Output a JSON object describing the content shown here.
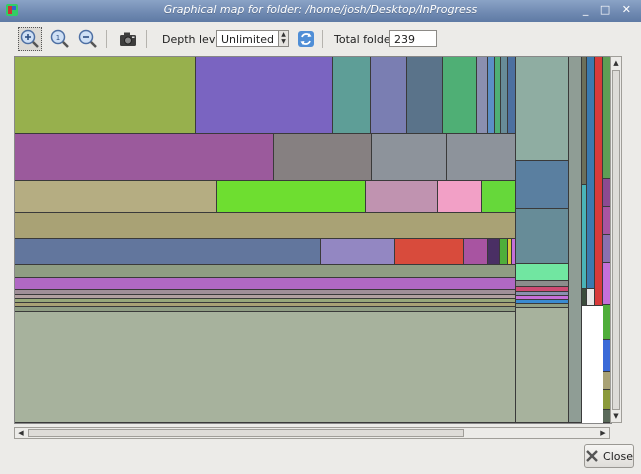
{
  "window": {
    "title": "Graphical map for folder: /home/josh/Desktop/InProgress",
    "controls": "_ □ ✕"
  },
  "toolbar": {
    "zoom_in_icon": "zoom-in-icon",
    "zoom_original_icon": "zoom-original-icon",
    "zoom_out_icon": "zoom-out-icon",
    "screenshot_icon": "camera-icon",
    "depth_label": "Depth level:",
    "depth_value": "Unlimited",
    "refresh_icon": "refresh-icon",
    "total_label": "Total folders:",
    "total_value": "239"
  },
  "treemap": {
    "colors": [
      "#97b04d",
      "#7a64c1",
      "#5e9e97",
      "#7a7eb2",
      "#5a738a",
      "#4faf75",
      "#8a8fb0",
      "#5b8fc7",
      "#9b5a9c",
      "#868081",
      "#8d939b",
      "#b5ad82",
      "#6ede30",
      "#c093b0",
      "#f2a0c6",
      "#66d83a",
      "#a9a275",
      "#62769d",
      "#9387c2",
      "#d84b3c",
      "#a854a1",
      "#4a2f64",
      "#4fae3a",
      "#a08f98",
      "#b2a0a0",
      "#8f9d95",
      "#678c98",
      "#4c70a0",
      "#5e9998",
      "#71e6a1",
      "#cf4a73",
      "#c56fd9",
      "#a7b29d",
      "#3b4c3c",
      "#d83a3a",
      "#8c4a92",
      "#3a8ad0"
    ]
  },
  "close_button": {
    "label": "Close",
    "icon": "close-icon"
  }
}
